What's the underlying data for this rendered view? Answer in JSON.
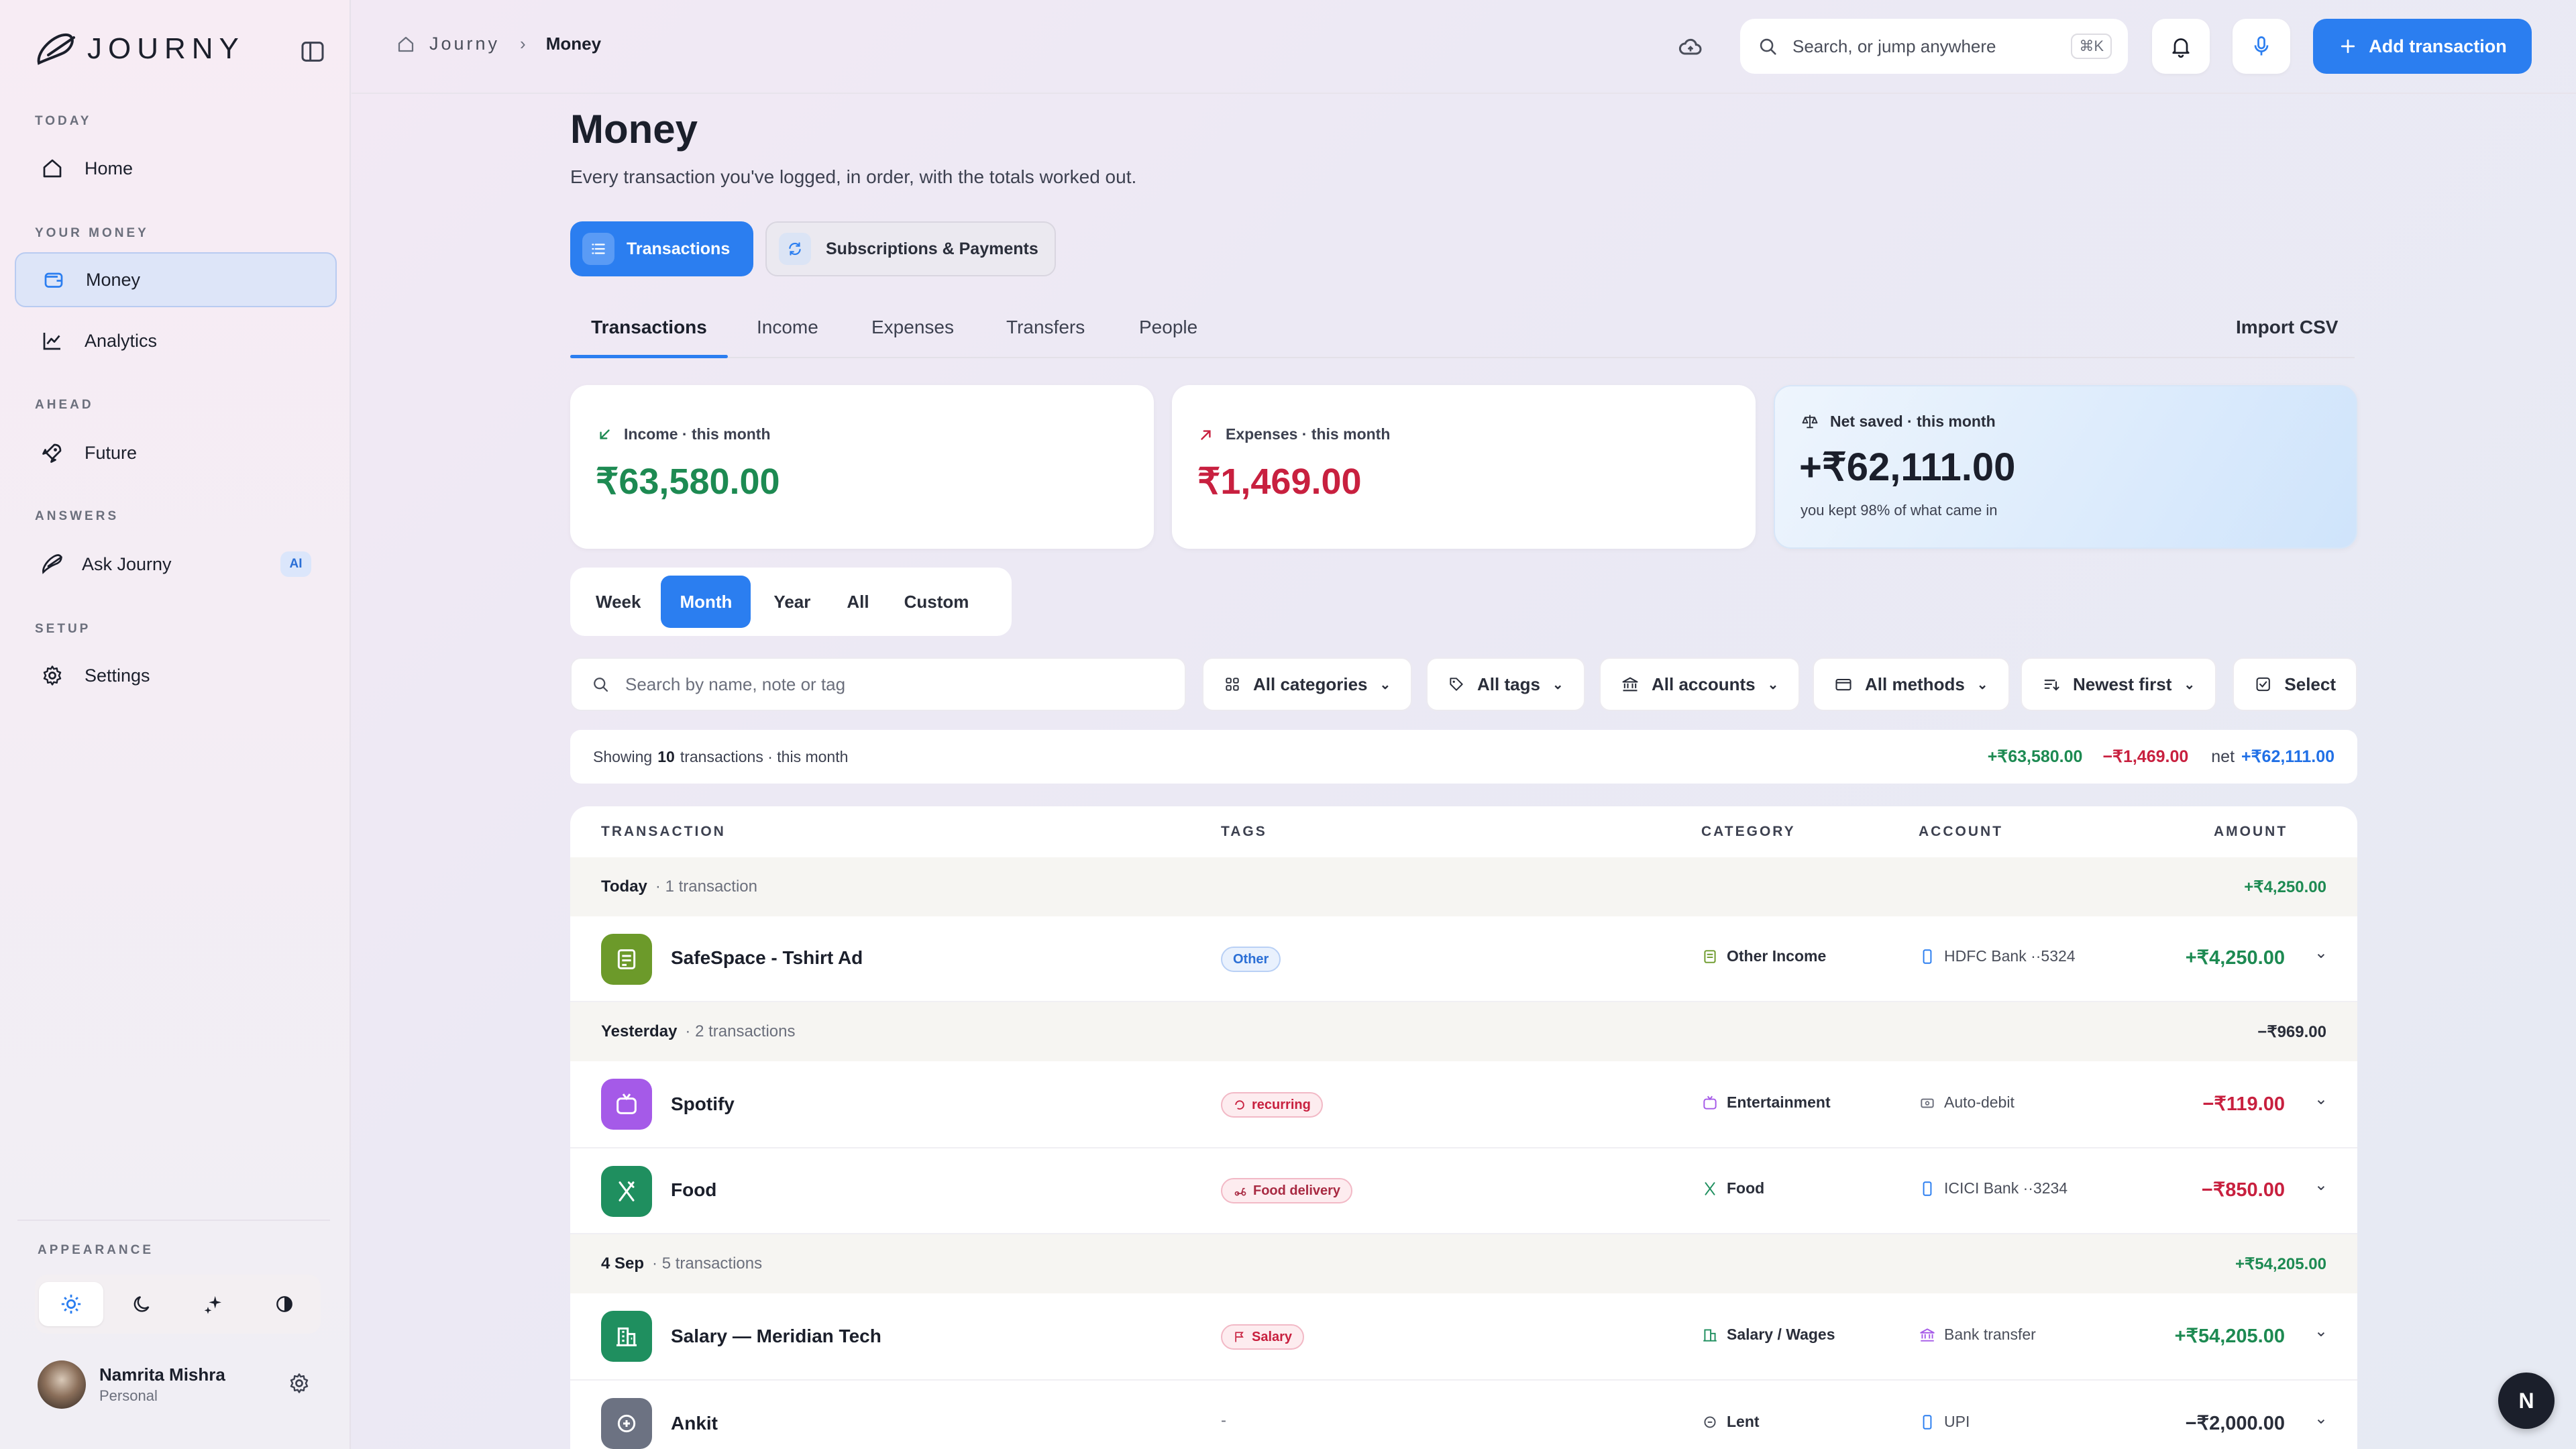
{
  "app": {
    "name": "JOURNY"
  },
  "sidebar": {
    "sections": [
      {
        "label": "TODAY",
        "items": [
          {
            "label": "Home"
          }
        ]
      },
      {
        "label": "YOUR MONEY",
        "items": [
          {
            "label": "Money"
          },
          {
            "label": "Analytics"
          }
        ]
      },
      {
        "label": "AHEAD",
        "items": [
          {
            "label": "Future"
          }
        ]
      },
      {
        "label": "ANSWERS",
        "items": [
          {
            "label": "Ask Journy",
            "badge": "AI"
          }
        ]
      },
      {
        "label": "SETUP",
        "items": [
          {
            "label": "Settings"
          }
        ]
      }
    ],
    "appearance_label": "APPEARANCE",
    "appearance_options": [
      "sun-icon",
      "moon-icon",
      "sparkle-icon",
      "contrast-icon"
    ],
    "user": {
      "name": "Namrita Mishra",
      "plan": "Personal"
    }
  },
  "header": {
    "breadcrumb": [
      "Journy",
      "Money"
    ],
    "search_placeholder": "Search, or jump anywhere",
    "search_shortcut": "⌘K",
    "add_button": "Add transaction",
    "accent": "#2b7ef0"
  },
  "page": {
    "title": "Money",
    "subtitle": "Every transaction you've logged, in order, with the totals worked out.",
    "segments": [
      "Transactions",
      "Subscriptions & Payments"
    ],
    "tabs": [
      "Transactions",
      "Income",
      "Expenses",
      "Transfers",
      "People"
    ],
    "import_csv": "Import CSV"
  },
  "summary": {
    "income": {
      "label": "Income · this month",
      "value": "₹63,580.00"
    },
    "expenses": {
      "label": "Expenses · this month",
      "value": "₹1,469.00"
    },
    "net": {
      "label": "Net saved · this month",
      "value": "+₹62,111.00",
      "note": "you kept 98% of what came in"
    }
  },
  "periods": {
    "options": [
      "Week",
      "Month",
      "Year",
      "All",
      "Custom"
    ],
    "selected": "Month"
  },
  "filters": {
    "search_placeholder": "Search by name, note or tag",
    "categories": "All categories",
    "tags": "All tags",
    "accounts": "All accounts",
    "methods": "All methods",
    "sort": "Newest first",
    "select": "Select"
  },
  "showing": {
    "prefix": "Showing",
    "count": "10",
    "suffix": "transactions · this month",
    "income": "+₹63,580.00",
    "expenses": "−₹1,469.00",
    "net_label": "net",
    "net": "+₹62,111.00"
  },
  "table": {
    "headers": [
      "TRANSACTION",
      "TAGS",
      "CATEGORY",
      "ACCOUNT",
      "AMOUNT"
    ],
    "groups": [
      {
        "date": "Today",
        "count": "· 1 transaction",
        "total": "+₹4,250.00"
      },
      {
        "date": "Yesterday",
        "count": "· 2 transactions",
        "total": "−₹969.00"
      },
      {
        "date": "4 Sep",
        "count": "· 5 transactions",
        "total": "+₹54,205.00"
      }
    ],
    "rows": [
      {
        "name": "SafeSpace - Tshirt Ad",
        "tag": "Other",
        "category": "Other Income",
        "account": "HDFC Bank ··5324",
        "amount": "+₹4,250.00"
      },
      {
        "name": "Spotify",
        "tag": "recurring",
        "category": "Entertainment",
        "account": "Auto-debit",
        "amount": "−₹119.00"
      },
      {
        "name": "Food",
        "tag": "Food delivery",
        "category": "Food",
        "account": "ICICI Bank ··3234",
        "amount": "−₹850.00"
      },
      {
        "name": "Salary — Meridian Tech",
        "tag": "Salary",
        "category": "Salary / Wages",
        "account": "Bank transfer",
        "amount": "+₹54,205.00"
      },
      {
        "name": "Ankit",
        "tag": "-",
        "category": "Lent",
        "account": "UPI",
        "amount": "−₹2,000.00"
      }
    ]
  },
  "fab": {
    "label": "N"
  }
}
